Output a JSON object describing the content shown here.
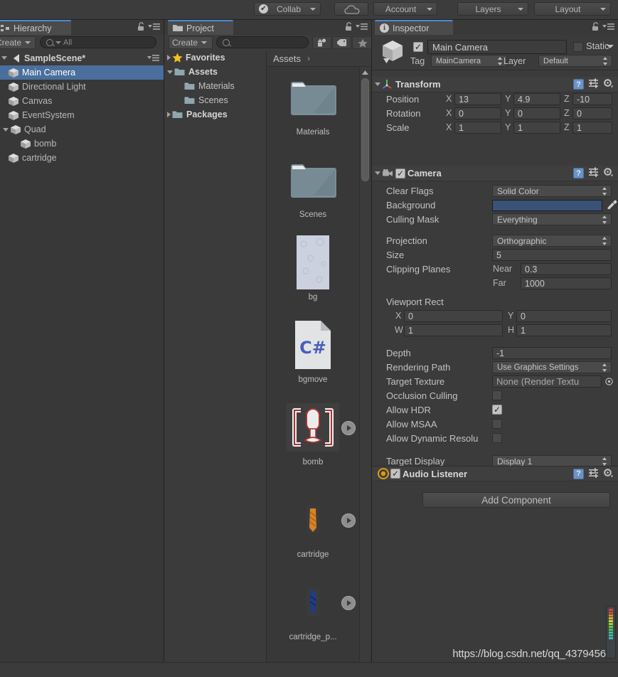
{
  "toolbar": {
    "collab_label": "Collab",
    "collab_check": "✔",
    "cloud_icon": "cloud-icon",
    "account_label": "Account",
    "layers_label": "Layers",
    "layout_label": "Layout"
  },
  "hierarchy": {
    "tab_label": "Hierarchy",
    "tab_icon": "hierarchy-icon",
    "create_label": "Create",
    "search_placeholder": "All",
    "search_value": "",
    "scene_name": "SampleScene*",
    "items": [
      {
        "label": "Main Camera",
        "depth": 1,
        "selected": true,
        "arrow": "none"
      },
      {
        "label": "Directional Light",
        "depth": 1,
        "selected": false,
        "arrow": "none"
      },
      {
        "label": "Canvas",
        "depth": 1,
        "selected": false,
        "arrow": "none"
      },
      {
        "label": "EventSystem",
        "depth": 1,
        "selected": false,
        "arrow": "none"
      },
      {
        "label": "Quad",
        "depth": 1,
        "selected": false,
        "arrow": "open"
      },
      {
        "label": "bomb",
        "depth": 2,
        "selected": false,
        "arrow": "none"
      },
      {
        "label": "cartridge",
        "depth": 1,
        "selected": false,
        "arrow": "none"
      }
    ]
  },
  "project": {
    "tab_label": "Project",
    "create_label": "Create",
    "search_placeholder": "",
    "search_value": "",
    "toolbar_icons": [
      "object-filter-icon",
      "label-filter-icon",
      "favorite-star-icon"
    ],
    "tree": [
      {
        "label": "Favorites",
        "type": "star",
        "arrow": "closed",
        "indent": 0,
        "bold": true
      },
      {
        "label": "Assets",
        "type": "folder",
        "arrow": "open",
        "indent": 0,
        "bold": true
      },
      {
        "label": "Materials",
        "type": "folder",
        "arrow": "none",
        "indent": 1,
        "bold": false
      },
      {
        "label": "Scenes",
        "type": "folder",
        "arrow": "none",
        "indent": 1,
        "bold": false
      },
      {
        "label": "Packages",
        "type": "folder",
        "arrow": "closed",
        "indent": 0,
        "bold": true
      }
    ],
    "breadcrumb_root": "Assets",
    "breadcrumb_sep": "›",
    "assets": [
      {
        "name": "Materials",
        "kind": "folder"
      },
      {
        "name": "Scenes",
        "kind": "folder"
      },
      {
        "name": "bg",
        "kind": "sprite-light"
      },
      {
        "name": "bgmove",
        "kind": "csharp"
      },
      {
        "name": "bomb",
        "kind": "prefab-bomb",
        "has_preview": true
      },
      {
        "name": "cartridge",
        "kind": "sprite-orange",
        "has_preview": true
      },
      {
        "name": "cartridge_p...",
        "kind": "sprite-blue",
        "has_preview": true
      }
    ]
  },
  "inspector": {
    "tab_label": "Inspector",
    "object_name": "Main Camera",
    "object_enabled": true,
    "static_label": "Static",
    "static_checked": false,
    "tag_label": "Tag",
    "tag_value": "MainCamera",
    "layer_label": "Layer",
    "layer_value": "Default",
    "transform": {
      "title": "Transform",
      "rows": [
        {
          "label": "Position",
          "x": "13",
          "y": "4.9",
          "z": "-10"
        },
        {
          "label": "Rotation",
          "x": "0",
          "y": "0",
          "z": "0"
        },
        {
          "label": "Scale",
          "x": "1",
          "y": "1",
          "z": "1"
        }
      ],
      "axis_labels": [
        "X",
        "Y",
        "Z"
      ]
    },
    "camera": {
      "title": "Camera",
      "enabled": true,
      "clear_flags_label": "Clear Flags",
      "clear_flags_value": "Solid Color",
      "background_label": "Background",
      "background_color": "#3a5278",
      "culling_mask_label": "Culling Mask",
      "culling_mask_value": "Everything",
      "projection_label": "Projection",
      "projection_value": "Orthographic",
      "size_label": "Size",
      "size_value": "5",
      "clipping_label": "Clipping Planes",
      "near_label": "Near",
      "near_value": "0.3",
      "far_label": "Far",
      "far_value": "1000",
      "viewport_label": "Viewport Rect",
      "viewport_x_label": "X",
      "viewport_x": "0",
      "viewport_y_label": "Y",
      "viewport_y": "0",
      "viewport_w_label": "W",
      "viewport_w": "1",
      "viewport_h_label": "H",
      "viewport_h": "1",
      "depth_label": "Depth",
      "depth_value": "-1",
      "rendering_path_label": "Rendering Path",
      "rendering_path_value": "Use Graphics Settings",
      "target_texture_label": "Target Texture",
      "target_texture_value": "None (Render Textu",
      "occlusion_label": "Occlusion Culling",
      "occlusion_checked": false,
      "hdr_label": "Allow HDR",
      "hdr_checked": true,
      "msaa_label": "Allow MSAA",
      "msaa_checked": false,
      "dynres_label": "Allow Dynamic Resolu",
      "dynres_checked": false,
      "target_display_label": "Target Display",
      "target_display_value": "Display 1"
    },
    "audio_listener": {
      "title": "Audio Listener",
      "enabled": true
    },
    "add_component_label": "Add Component"
  },
  "watermark": "https://blog.csdn.net/qq_43794560",
  "colors": {
    "selection_blue": "#4a6f9c",
    "tab_accent": "#4b8bd6",
    "panel_bg": "#3b3b3b",
    "camera_background": "#3a5278"
  }
}
